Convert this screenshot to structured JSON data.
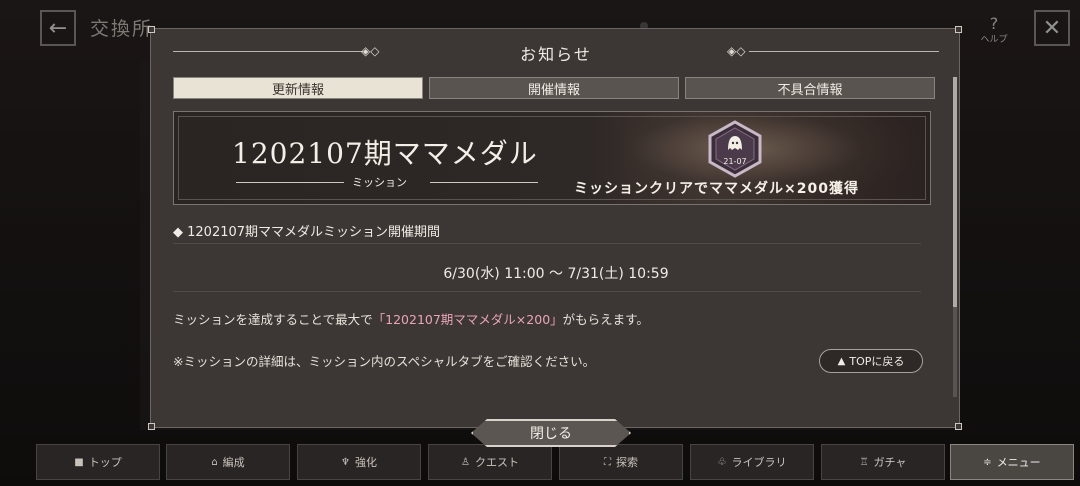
{
  "header": {
    "title": "交換所",
    "help_label": "ヘルプ"
  },
  "modal": {
    "title": "お知らせ",
    "tabs": [
      {
        "label": "更新情報",
        "active": true
      },
      {
        "label": "開催情報",
        "active": false
      },
      {
        "label": "不具合情報",
        "active": false
      }
    ],
    "banner": {
      "title": "1202107期ママメダル",
      "subtitle": "ミッション",
      "medal_label": "21-07",
      "caption": "ミッションクリアでママメダル×200獲得"
    },
    "section_heading": "◆ 1202107期ママメダルミッション開催期間",
    "period": "6/30(水) 11:00 ～ 7/31(土) 10:59",
    "body_1_prefix": "ミッションを達成することで最大で",
    "body_1_highlight": "「1202107期ママメダル×200」",
    "body_1_suffix": "がもらえます。",
    "body_2": "※ミッションの詳細は、ミッション内のスペシャルタブをご確認ください。",
    "top_button_label": "TOPに戻る",
    "close_label": "閉じる"
  },
  "bottom_nav": [
    {
      "label": "トップ",
      "icon": "■"
    },
    {
      "label": "編成",
      "icon": "⌂"
    },
    {
      "label": "強化",
      "icon": "♆"
    },
    {
      "label": "クエスト",
      "icon": "♙"
    },
    {
      "label": "探索",
      "icon": "⛶"
    },
    {
      "label": "ライブラリ",
      "icon": "♧"
    },
    {
      "label": "ガチャ",
      "icon": "♖"
    },
    {
      "label": "メニュー",
      "icon": "≑"
    }
  ],
  "colors": {
    "accent_highlight": "#e9a5b5",
    "active_tab": "#e9e3d6"
  }
}
